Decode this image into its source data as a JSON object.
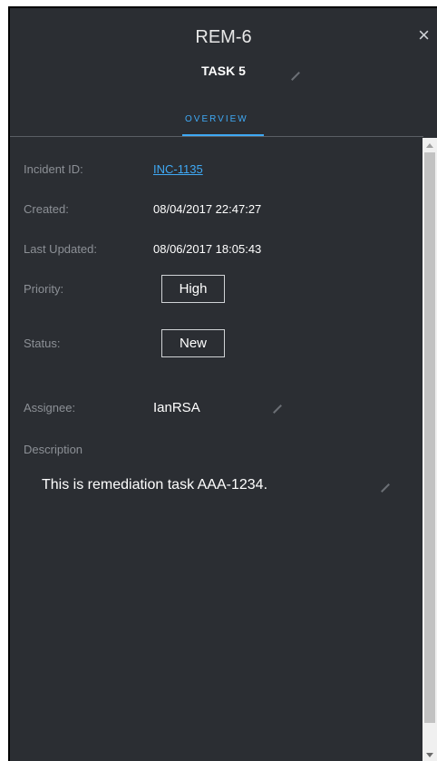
{
  "header": {
    "title": "REM-6",
    "subtitle": "TASK 5",
    "close_label": "×",
    "close_icon": "close-icon",
    "edit_icon": "pencil-icon"
  },
  "tabs": [
    {
      "label": "OVERVIEW",
      "active": true
    }
  ],
  "fields": {
    "incident_id": {
      "label": "Incident ID:",
      "value": "INC-1135"
    },
    "created": {
      "label": "Created:",
      "value": "08/04/2017 22:47:27"
    },
    "last_updated": {
      "label": "Last Updated:",
      "value": "08/06/2017 18:05:43"
    },
    "priority": {
      "label": "Priority:",
      "value": "High"
    },
    "status": {
      "label": "Status:",
      "value": "New"
    },
    "assignee": {
      "label": "Assignee:",
      "value": "IanRSA"
    },
    "description": {
      "label": "Description",
      "value": "This is remediation task AAA-1234."
    }
  },
  "colors": {
    "panel_bg": "#2b2e33",
    "accent": "#3fa9f5",
    "label": "#8c9096",
    "text": "#ffffff"
  }
}
